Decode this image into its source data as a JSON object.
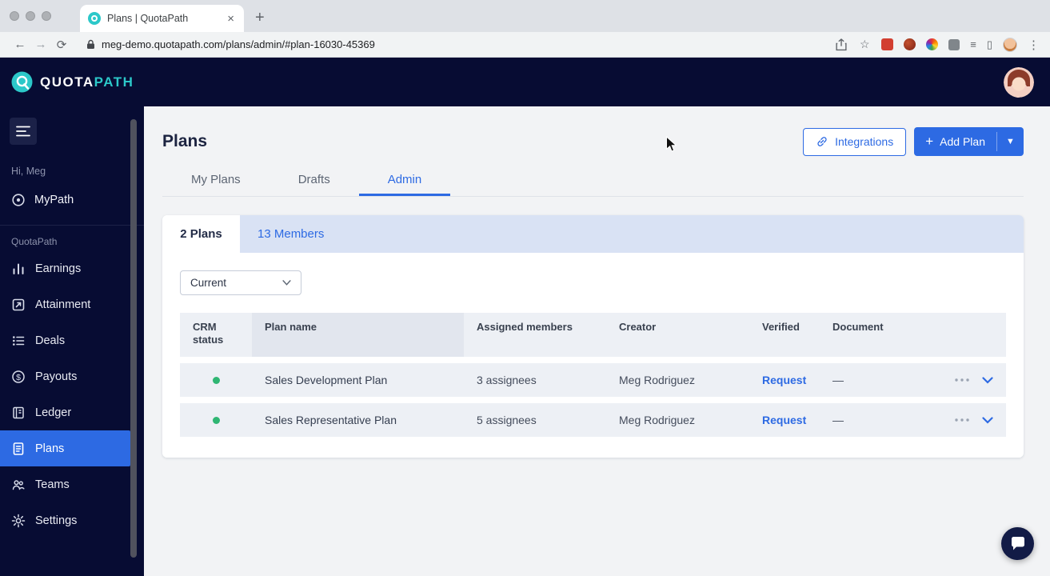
{
  "browser": {
    "tab_title": "Plans | QuotaPath",
    "url": "meg-demo.quotapath.com/plans/admin/#plan-16030-45369"
  },
  "icons": {
    "close_tab": "×",
    "new_tab": "+",
    "back": "←",
    "forward": "→",
    "reload": "⟳",
    "star": "☆",
    "kebab": "⋮",
    "lines": "≡",
    "panel": "▯",
    "add": "+",
    "caret": "▼",
    "dollar": "$"
  },
  "app_header": {
    "logo_part1": "QUOTA",
    "logo_part2": "PATH"
  },
  "sidebar": {
    "greeting": "Hi, Meg",
    "mypath_label": "MyPath",
    "section_label": "QuotaPath",
    "items": [
      {
        "label": "Earnings"
      },
      {
        "label": "Attainment"
      },
      {
        "label": "Deals"
      },
      {
        "label": "Payouts"
      },
      {
        "label": "Ledger"
      },
      {
        "label": "Plans"
      },
      {
        "label": "Teams"
      },
      {
        "label": "Settings"
      }
    ]
  },
  "main": {
    "title": "Plans",
    "integrations_label": "Integrations",
    "add_plan_label": "Add Plan",
    "tabs": [
      {
        "label": "My Plans"
      },
      {
        "label": "Drafts"
      },
      {
        "label": "Admin"
      }
    ],
    "card": {
      "plans_tab": "2 Plans",
      "members_tab": "13 Members",
      "filter_value": "Current",
      "table": {
        "headers": [
          "CRM status",
          "Plan name",
          "Assigned members",
          "Creator",
          "Verified",
          "Document"
        ],
        "rows": [
          {
            "plan_name": "Sales Development Plan",
            "assigned_members": "3 assignees",
            "creator": "Meg Rodriguez",
            "verified": "Request",
            "document": "—"
          },
          {
            "plan_name": "Sales Representative Plan",
            "assigned_members": "5 assignees",
            "creator": "Meg Rodriguez",
            "verified": "Request",
            "document": "—"
          }
        ]
      }
    }
  },
  "colors": {
    "navy": "#070c33",
    "teal": "#2cc8c9",
    "accent_blue": "#2d6ae3",
    "status_green": "#2fb673",
    "members_strip": "#d9e2f4"
  }
}
